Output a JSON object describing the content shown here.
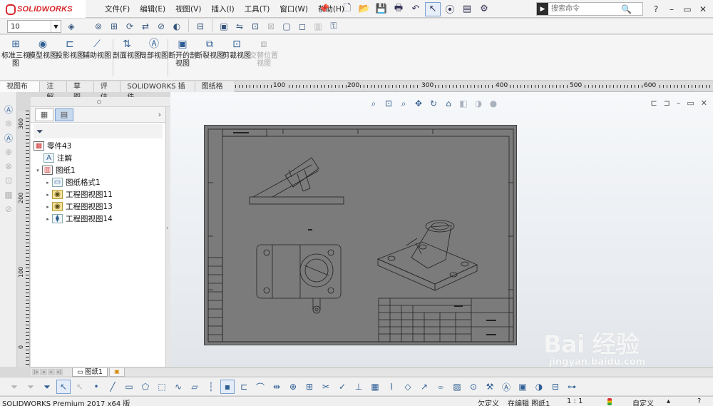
{
  "app": {
    "logo_text": "SOLIDWORKS"
  },
  "menu": [
    "文件(F)",
    "编辑(E)",
    "视图(V)",
    "插入(I)",
    "工具(T)",
    "窗口(W)",
    "帮助(H)"
  ],
  "search": {
    "placeholder": "搜索命令"
  },
  "window_controls": [
    "?",
    "–",
    "▭",
    "✕"
  ],
  "scale_value": "10",
  "ribbon": {
    "buttons": [
      {
        "label": "标准三视图",
        "icon": "standard-views-icon"
      },
      {
        "label": "模型视图",
        "icon": "model-view-icon"
      },
      {
        "label": "投影视图",
        "icon": "projected-view-icon"
      },
      {
        "label": "辅助视图",
        "icon": "auxiliary-view-icon"
      },
      {
        "label": "剖面视图",
        "icon": "section-view-icon"
      },
      {
        "label": "局部视图",
        "icon": "detail-view-icon"
      },
      {
        "label": "断开的剖视图",
        "icon": "broken-out-section-icon"
      },
      {
        "label": "断裂视图",
        "icon": "break-view-icon"
      },
      {
        "label": "剪裁视图",
        "icon": "crop-view-icon"
      },
      {
        "label": "交替位置视图",
        "icon": "alternate-position-view-icon"
      }
    ]
  },
  "tabs": [
    "视图布局",
    "注解",
    "草图",
    "评估",
    "SOLIDWORKS 插件",
    "图纸格式"
  ],
  "ruler_top_labels": [
    "100",
    "200",
    "300",
    "400",
    "500",
    "600"
  ],
  "ruler_left_labels": [
    "300",
    "200",
    "100",
    "0"
  ],
  "tree": {
    "root": "零件43",
    "items": [
      {
        "label": "注解",
        "level": 1,
        "expand": ""
      },
      {
        "label": "图纸1",
        "level": 1,
        "expand": "▾"
      },
      {
        "label": "图纸格式1",
        "level": 2,
        "expand": "▸"
      },
      {
        "label": "工程图视图11",
        "level": 2,
        "expand": "▸"
      },
      {
        "label": "工程图视图13",
        "level": 2,
        "expand": "▸"
      },
      {
        "label": "工程图视图14",
        "level": 2,
        "expand": "▸"
      }
    ]
  },
  "sheet_tab": "图纸1",
  "status": {
    "app_version": "SOLIDWORKS Premium 2017 x64 版",
    "definition": "欠定义",
    "editing": "在编辑 图纸1",
    "scale": "1 : 1",
    "units": "自定义"
  },
  "watermark": {
    "text": "Bai 经验",
    "url": "jingyan.baidu.com"
  },
  "colors": {
    "sheet_bg": "#7b7b7b",
    "brand_red": "#d8282d",
    "accent_blue": "#2f5f95"
  }
}
